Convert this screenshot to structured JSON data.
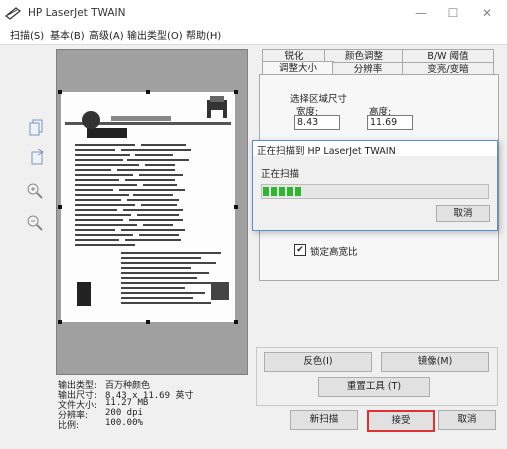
{
  "window": {
    "title": "HP LaserJet TWAIN",
    "minimize": "—",
    "maximize": "☐",
    "close": "✕"
  },
  "menu": [
    {
      "label": "扫描(S)"
    },
    {
      "label": "基本(B)"
    },
    {
      "label": "高级(A)"
    },
    {
      "label": "输出类型(O)"
    },
    {
      "label": "帮助(H)"
    }
  ],
  "preview": {
    "doc_header": "HP LaserJet MFP M436n",
    "doc_section": "打印机测试页"
  },
  "tools": [
    {
      "icon": "scan-area-icon"
    },
    {
      "icon": "rotate-icon"
    },
    {
      "icon": "zoom-in-icon"
    },
    {
      "icon": "zoom-out-icon"
    }
  ],
  "info": {
    "output_type_label": "输出类型:",
    "output_type_value": "百万种颜色",
    "output_size_label": "输出尺寸:",
    "output_size_value": "8.43 x 11.69 英寸",
    "file_size_label": "文件大小:",
    "file_size_value": "11.27 MB",
    "resolution_label": "分辨率:",
    "resolution_value": "200 dpi",
    "scale_label": "比例:",
    "scale_value": "100.00%"
  },
  "tabs": {
    "row1": [
      "锐化",
      "颜色调整",
      "B/W 阈值"
    ],
    "row2": [
      "调整大小",
      "分辨率",
      "变亮/变暗"
    ]
  },
  "size_panel": {
    "group_label": "选择区域尺寸",
    "width_label": "宽度:",
    "width_value": "8.43",
    "height_label": "高度:",
    "height_value": "11.69",
    "lock_label": "锁定高宽比",
    "lock_checked": "✔"
  },
  "buttons": {
    "invert": "反色(I)",
    "mirror": "镜像(M)",
    "reset_tools": "重置工具 (T)",
    "new_scan": "新扫描",
    "accept": "接受",
    "cancel": "取消"
  },
  "dialog": {
    "title": "正在扫描到 HP LaserJet  TWAIN",
    "status": "正在扫描",
    "progress": 0.17,
    "cancel": "取消"
  },
  "colors": {
    "progress_green": "#2fb52f",
    "highlight_red": "#e03030"
  }
}
